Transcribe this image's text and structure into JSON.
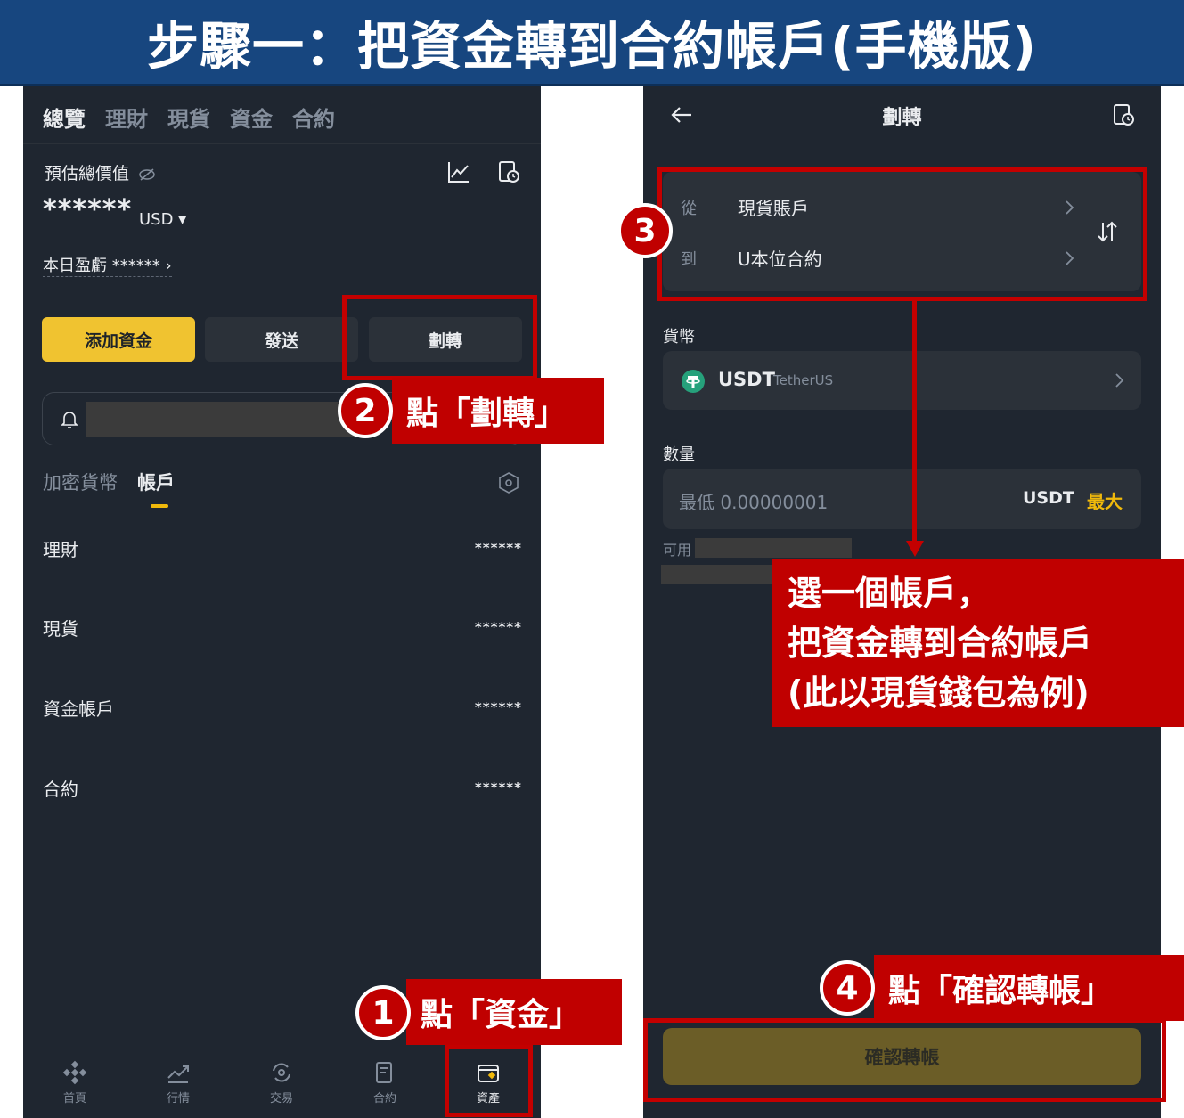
{
  "title": "步驟一：把資金轉到合約帳戶(手機版)",
  "left_phone": {
    "top_tabs": [
      "總覽",
      "理財",
      "現貨",
      "資金",
      "合約"
    ],
    "est_label": "預估總價值",
    "hidden_value": "******",
    "currency": "USD ▾",
    "today_pnl": "本日盈虧 ****** ›",
    "buttons": {
      "add": "添加資金",
      "send": "發送",
      "transfer": "劃轉"
    },
    "sub_tabs": [
      "加密貨幣",
      "帳戶"
    ],
    "accounts": [
      {
        "name": "理財",
        "value": "******"
      },
      {
        "name": "現貨",
        "value": "******"
      },
      {
        "name": "資金帳戶",
        "value": "******"
      },
      {
        "name": "合約",
        "value": "******"
      }
    ],
    "bottom_nav": [
      "首頁",
      "行情",
      "交易",
      "合約",
      "資產"
    ]
  },
  "right_phone": {
    "header_title": "劃轉",
    "from_label": "從",
    "from_value": "現貨賬戶",
    "to_label": "到",
    "to_value": "U本位合約",
    "currency_label": "貨幣",
    "coin": "USDT",
    "coin_name": "TetherUS",
    "amount_label": "數量",
    "amount_placeholder": "最低 0.00000001",
    "amount_unit": "USDT",
    "max_label": "最大",
    "available_label": "可用",
    "confirm": "確認轉帳"
  },
  "annotations": {
    "step1": {
      "num": "1",
      "text": "點「資金」"
    },
    "step2": {
      "num": "2",
      "text": "點「劃轉」"
    },
    "step3": {
      "num": "3",
      "lines": [
        "選一個帳戶，",
        "把資金轉到合約帳戶",
        "(此以現貨錢包為例)"
      ]
    },
    "step4": {
      "num": "4",
      "text": "點「確認轉帳」"
    }
  },
  "colors": {
    "title_bg": "#17467f",
    "app_bg": "#1f2630",
    "accent_yellow": "#f0c330",
    "annotation_red": "#c00000"
  }
}
